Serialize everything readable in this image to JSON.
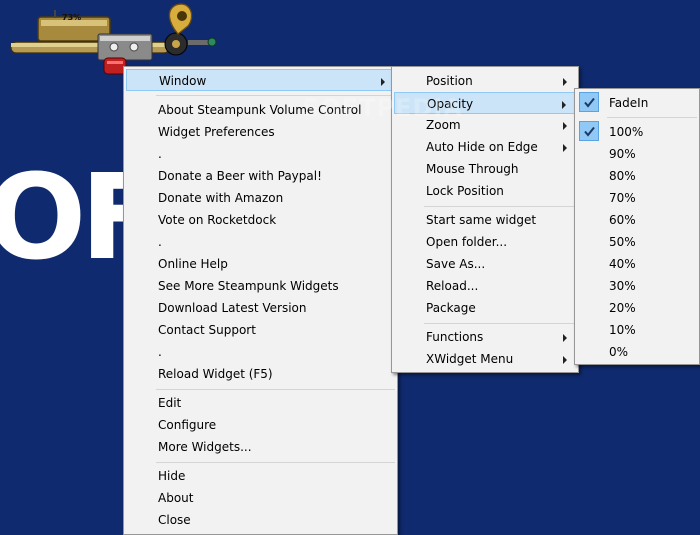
{
  "desktop": {
    "big_text": "OF",
    "watermark": "SOFTPEDIA"
  },
  "widget": {
    "volume_label": "73%"
  },
  "main_menu": {
    "items": [
      "Window",
      "About Steampunk Volume Control",
      "Widget Preferences",
      ".",
      "Donate a Beer with Paypal!",
      "Donate with Amazon",
      "Vote on Rocketdock",
      ".",
      "Online Help",
      "See More Steampunk Widgets",
      "Download Latest Version",
      "Contact Support",
      ".",
      "Reload Widget (F5)",
      "Edit",
      "Configure",
      "More Widgets...",
      "Hide",
      "About",
      "Close"
    ]
  },
  "window_submenu": {
    "items": [
      "Position",
      "Opacity",
      "Zoom",
      "Auto Hide on Edge",
      "Mouse Through",
      "Lock Position",
      "Start same widget",
      "Open folder...",
      "Save As...",
      "Reload...",
      "Package",
      "Functions",
      "XWidget Menu"
    ]
  },
  "opacity_submenu": {
    "fadein": "FadeIn",
    "levels": [
      "100%",
      "90%",
      "80%",
      "70%",
      "60%",
      "50%",
      "40%",
      "30%",
      "20%",
      "10%",
      "0%"
    ]
  },
  "colors": {
    "desktop": "#0f2a6e",
    "menu_bg": "#f2f2f2",
    "highlight": "#cce4f7",
    "check": "#90c8f6"
  }
}
